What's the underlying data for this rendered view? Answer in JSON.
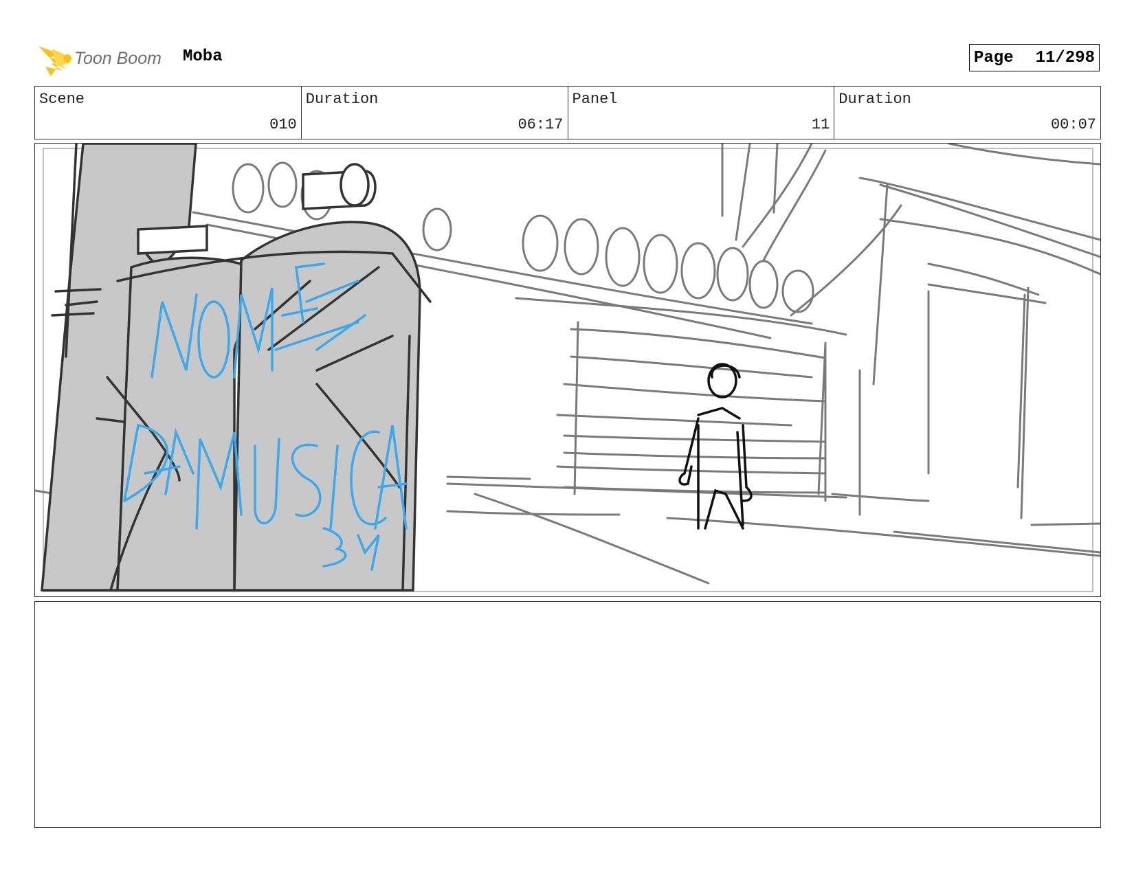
{
  "header": {
    "logo_text": "Toon Boom",
    "project_title": "Moba",
    "page_label": "Page",
    "page_value": "11/298"
  },
  "info": {
    "scene_label": "Scene",
    "scene_value": "010",
    "scene_duration_label": "Duration",
    "scene_duration_value": "06:17",
    "panel_label": "Panel",
    "panel_value": "11",
    "panel_duration_label": "Duration",
    "panel_duration_value": "00:07"
  },
  "panel": {
    "graffiti_text": "NOME DA MUSICA BY"
  },
  "colors": {
    "sketch_gray": "#7a7a7a",
    "fill_gray": "#c8c8c8",
    "graffiti_blue": "#3aa9ee",
    "logo_yellow": "#f6c21b",
    "logo_text_gray": "#6e6e6e"
  }
}
